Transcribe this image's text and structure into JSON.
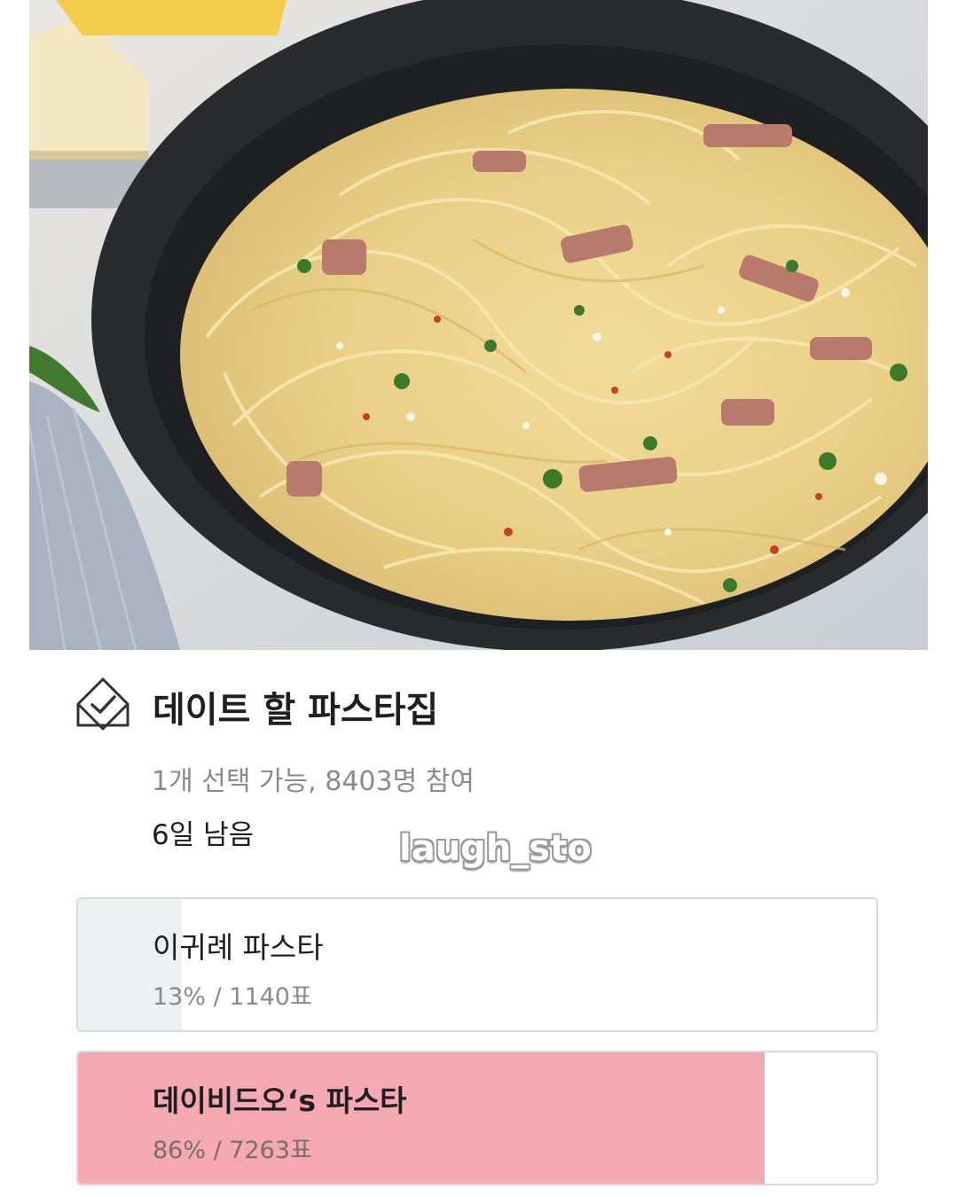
{
  "photo": {
    "description_icon": "pasta-photo"
  },
  "poll": {
    "icon": "checkmark-diamond-icon",
    "title": "데이트 할 파스타집",
    "meta": "1개 선택 가능, 8403명 참여",
    "remaining": "6일 남음",
    "options": [
      {
        "label": "이귀례 파스타",
        "stats": "13% / 1140표",
        "percent": 13,
        "color": "#eef0f2"
      },
      {
        "label": "데이비드오‘s 파스타",
        "stats": "86% / 7263표",
        "percent": 86,
        "color": "#f4a9b2"
      }
    ]
  },
  "watermark": "laugh_sto"
}
